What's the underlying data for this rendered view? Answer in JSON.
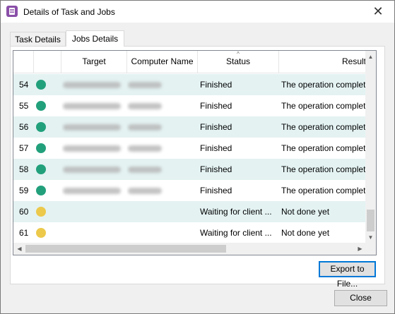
{
  "window": {
    "title": "Details of Task and Jobs",
    "close_glyph": "✕",
    "icon": "app-task-icon"
  },
  "tabs": [
    {
      "label": "Task Details",
      "selected": false
    },
    {
      "label": "Jobs Details",
      "selected": true
    }
  ],
  "grid": {
    "columns": [
      "",
      "",
      "Target",
      "Computer Name",
      "Status",
      "Result"
    ],
    "sorted_column": "Status",
    "sort_glyph": "^",
    "rows": [
      {
        "num": "54",
        "status_color": "#22a07c",
        "target_redacted": true,
        "computer_redacted": true,
        "status": "Finished",
        "result": "The operation completed"
      },
      {
        "num": "55",
        "status_color": "#22a07c",
        "target_redacted": true,
        "computer_redacted": true,
        "status": "Finished",
        "result": "The operation completed"
      },
      {
        "num": "56",
        "status_color": "#22a07c",
        "target_redacted": true,
        "computer_redacted": true,
        "status": "Finished",
        "result": "The operation completed"
      },
      {
        "num": "57",
        "status_color": "#22a07c",
        "target_redacted": true,
        "computer_redacted": true,
        "status": "Finished",
        "result": "The operation completed"
      },
      {
        "num": "58",
        "status_color": "#22a07c",
        "target_redacted": true,
        "computer_redacted": true,
        "status": "Finished",
        "result": "The operation completed"
      },
      {
        "num": "59",
        "status_color": "#22a07c",
        "target_redacted": true,
        "computer_redacted": true,
        "status": "Finished",
        "result": "The operation completed"
      },
      {
        "num": "60",
        "status_color": "#ecc94b",
        "target_redacted": false,
        "computer_redacted": false,
        "status": "Waiting for client ...",
        "result": "Not done yet"
      },
      {
        "num": "61",
        "status_color": "#ecc94b",
        "target_redacted": false,
        "computer_redacted": false,
        "status": "Waiting for client ...",
        "result": "Not done yet"
      }
    ]
  },
  "scrollbars": {
    "up": "▲",
    "down": "▼",
    "left": "◀",
    "right": "▶"
  },
  "buttons": {
    "export": "Export to File...",
    "close": "Close"
  }
}
